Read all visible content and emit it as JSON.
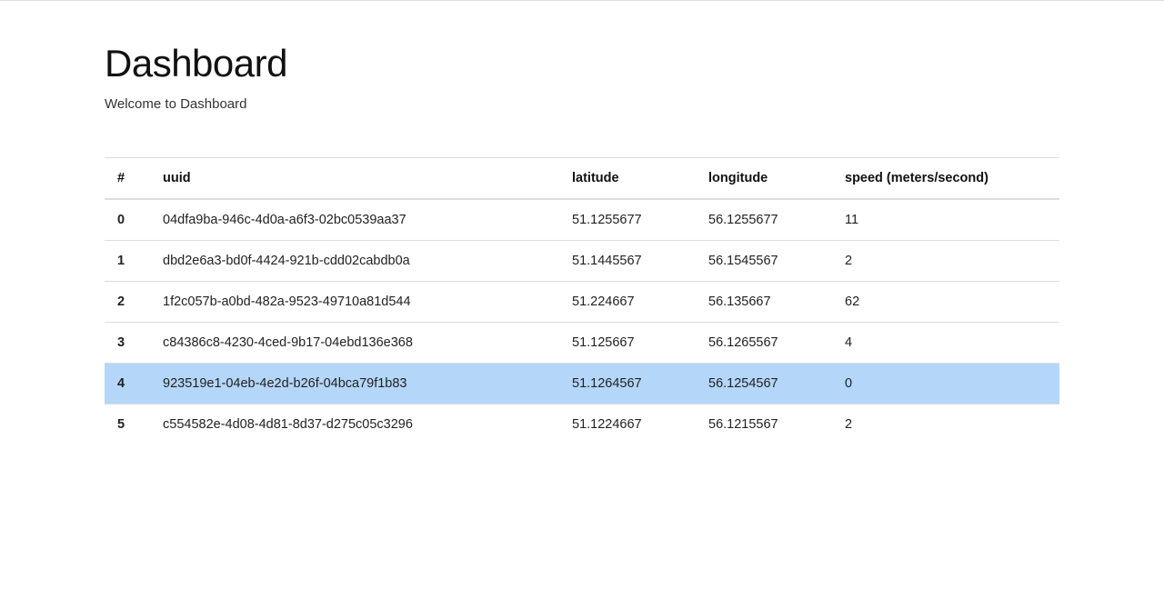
{
  "page": {
    "title": "Dashboard",
    "subtitle": "Welcome to Dashboard"
  },
  "table": {
    "headers": {
      "index": "#",
      "uuid": "uuid",
      "latitude": "latitude",
      "longitude": "longitude",
      "speed": "speed (meters/second)"
    },
    "rows": [
      {
        "index": "0",
        "uuid": "04dfa9ba-946c-4d0a-a6f3-02bc0539aa37",
        "latitude": "51.1255677",
        "longitude": "56.1255677",
        "speed": "11",
        "highlight": false
      },
      {
        "index": "1",
        "uuid": "dbd2e6a3-bd0f-4424-921b-cdd02cabdb0a",
        "latitude": "51.1445567",
        "longitude": "56.1545567",
        "speed": "2",
        "highlight": false
      },
      {
        "index": "2",
        "uuid": "1f2c057b-a0bd-482a-9523-49710a81d544",
        "latitude": "51.224667",
        "longitude": "56.135667",
        "speed": "62",
        "highlight": false
      },
      {
        "index": "3",
        "uuid": "c84386c8-4230-4ced-9b17-04ebd136e368",
        "latitude": "51.125667",
        "longitude": "56.1265567",
        "speed": "4",
        "highlight": false
      },
      {
        "index": "4",
        "uuid": "923519e1-04eb-4e2d-b26f-04bca79f1b83",
        "latitude": "51.1264567",
        "longitude": "56.1254567",
        "speed": "0",
        "highlight": true
      },
      {
        "index": "5",
        "uuid": "c554582e-4d08-4d81-8d37-d275c05c3296",
        "latitude": "51.1224667",
        "longitude": "56.1215567",
        "speed": "2",
        "highlight": false
      }
    ]
  }
}
